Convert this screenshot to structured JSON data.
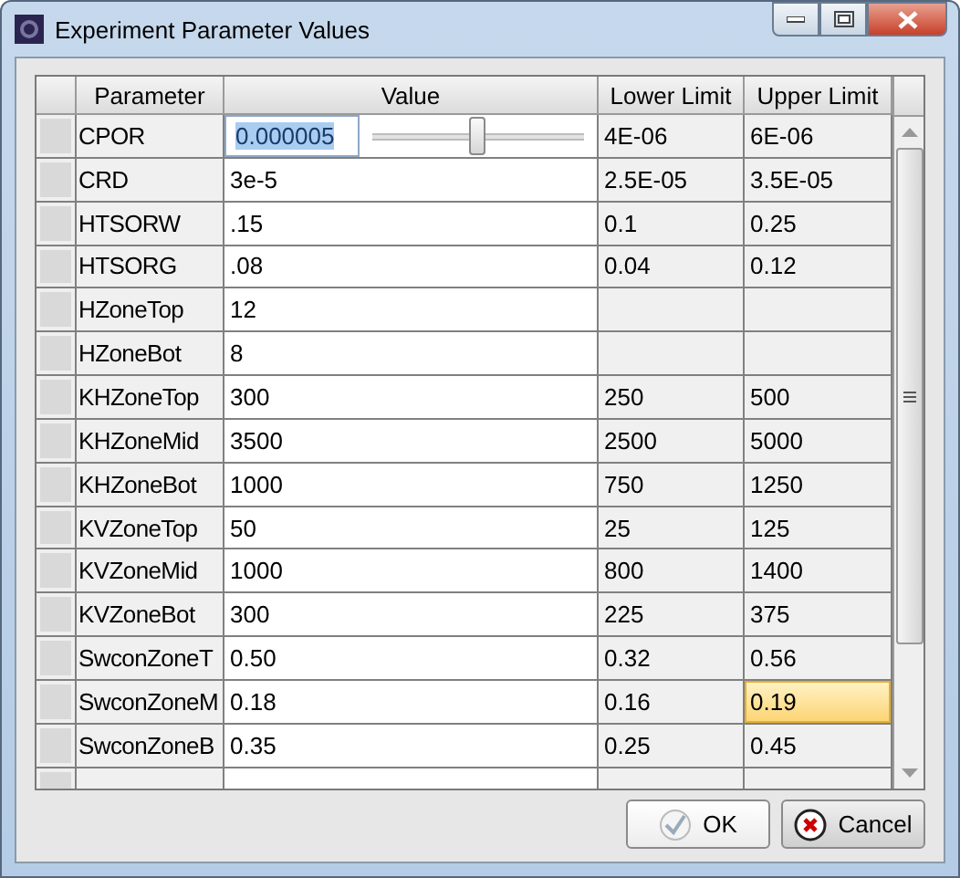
{
  "window": {
    "title": "Experiment Parameter Values"
  },
  "table": {
    "columns": [
      "Parameter",
      "Value",
      "Lower Limit",
      "Upper Limit"
    ],
    "rows": [
      {
        "parameter": "CPOR",
        "value": {
          "kind": "slider",
          "text": "0.000005",
          "level": 0.5
        },
        "lower": "4E-06",
        "upper": {
          "text": "6E-06",
          "selected": false
        }
      },
      {
        "parameter": "CRD",
        "value": {
          "kind": "text",
          "text": "3e-5"
        },
        "lower": "2.5E-05",
        "upper": {
          "text": "3.5E-05",
          "selected": false
        }
      },
      {
        "parameter": "HTSORW",
        "value": {
          "kind": "text",
          "text": ".15"
        },
        "lower": "0.1",
        "upper": {
          "text": "0.25",
          "selected": false
        }
      },
      {
        "parameter": "HTSORG",
        "value": {
          "kind": "text",
          "text": ".08"
        },
        "lower": "0.04",
        "upper": {
          "text": "0.12",
          "selected": false
        }
      },
      {
        "parameter": "HZoneTop",
        "value": {
          "kind": "text",
          "text": "12"
        }
      },
      {
        "parameter": "HZoneBot",
        "value": {
          "kind": "text",
          "text": "8"
        }
      },
      {
        "parameter": "KHZoneTop",
        "value": {
          "kind": "text",
          "text": "300"
        },
        "lower": "250",
        "upper": {
          "text": "500",
          "selected": false
        }
      },
      {
        "parameter": "KHZoneMid",
        "value": {
          "kind": "text",
          "text": "3500"
        },
        "lower": "2500",
        "upper": {
          "text": "5000",
          "selected": false
        }
      },
      {
        "parameter": "KHZoneBot",
        "value": {
          "kind": "text",
          "text": "1000"
        },
        "lower": "750",
        "upper": {
          "text": "1250",
          "selected": false
        }
      },
      {
        "parameter": "KVZoneTop",
        "value": {
          "kind": "text",
          "text": "50"
        },
        "lower": "25",
        "upper": {
          "text": "125",
          "selected": false
        }
      },
      {
        "parameter": "KVZoneMid",
        "value": {
          "kind": "text",
          "text": "1000"
        },
        "lower": "800",
        "upper": {
          "text": "1400",
          "selected": false
        }
      },
      {
        "parameter": "KVZoneBot",
        "value": {
          "kind": "text",
          "text": "300"
        },
        "lower": "225",
        "upper": {
          "text": "375",
          "selected": false
        }
      },
      {
        "parameter": "SwconZoneT",
        "value": {
          "kind": "text",
          "text": "0.50"
        },
        "lower": "0.32",
        "upper": {
          "text": "0.56",
          "selected": false
        }
      },
      {
        "parameter": "SwconZoneM",
        "value": {
          "kind": "text",
          "text": "0.18"
        },
        "lower": "0.16",
        "upper": {
          "text": "0.19",
          "selected": true
        }
      },
      {
        "parameter": "SwconZoneB",
        "value": {
          "kind": "text",
          "text": "0.35"
        },
        "lower": "0.25",
        "upper": {
          "text": "0.45",
          "selected": false
        }
      }
    ]
  },
  "buttons": [
    {
      "kind": "ok",
      "label": "OK"
    },
    {
      "kind": "cancel",
      "label": "Cancel"
    }
  ]
}
